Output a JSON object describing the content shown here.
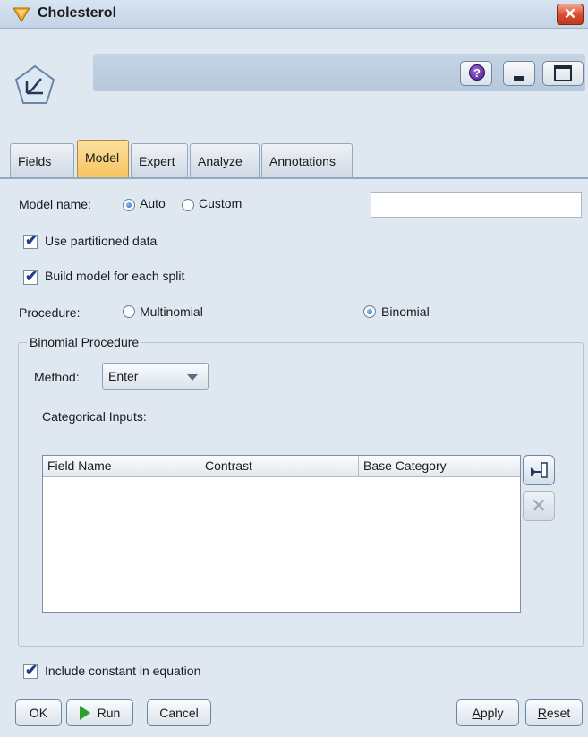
{
  "window": {
    "title": "Cholesterol",
    "close_glyph": "✕"
  },
  "header": {
    "help_glyph": "?"
  },
  "tabs": [
    {
      "label": "Fields",
      "active": false
    },
    {
      "label": "Model",
      "active": true
    },
    {
      "label": "Expert",
      "active": false
    },
    {
      "label": "Analyze",
      "active": false
    },
    {
      "label": "Annotations",
      "active": false
    }
  ],
  "model": {
    "model_name_label": "Model name:",
    "auto_label": "Auto",
    "custom_label": "Custom",
    "model_name_mode": "Auto",
    "custom_name_value": "",
    "use_partitioned_label": "Use partitioned data",
    "use_partitioned_checked": true,
    "build_each_split_label": "Build model for each split",
    "build_each_split_checked": true,
    "procedure_label": "Procedure:",
    "multinomial_label": "Multinomial",
    "binomial_label": "Binomial",
    "procedure_value": "Binomial"
  },
  "binomial": {
    "legend": "Binomial Procedure",
    "method_label": "Method:",
    "method_value": "Enter",
    "categorical_inputs_label": "Categorical Inputs:",
    "table": {
      "columns": [
        "Field Name",
        "Contrast",
        "Base Category"
      ],
      "rows": []
    },
    "delete_glyph": "✕"
  },
  "include_constant_label": "Include constant in equation",
  "include_constant_checked": true,
  "buttons": {
    "ok": "OK",
    "run": "Run",
    "cancel": "Cancel",
    "apply_a": "A",
    "apply_rest": "pply",
    "reset_r": "R",
    "reset_rest": "eset"
  },
  "colors": {
    "active_tab": "#f7c35c",
    "background": "#dfe8f1",
    "close_button": "#d64b2c",
    "run_icon": "#2f9e2f"
  }
}
